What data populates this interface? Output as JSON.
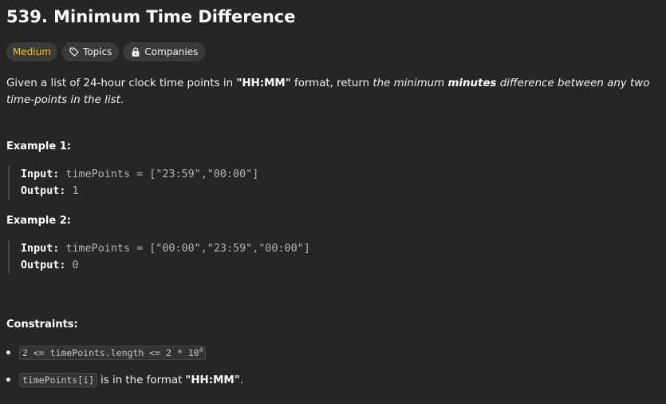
{
  "problem": {
    "title": "539. Minimum Time Difference",
    "difficulty": "Medium",
    "difficulty_color": "#ffc01e",
    "tags": [
      {
        "label": "Topics",
        "icon": "tag-icon"
      },
      {
        "label": "Companies",
        "icon": "lock-icon"
      }
    ]
  },
  "description": {
    "part1": "Given a list of 24-hour clock time points in ",
    "format": "\"HH:MM\"",
    "part2": " format, return ",
    "ital1": "the minimum ",
    "ital_bold": "minutes",
    "ital2": " difference between any two time-points in the list",
    "end": "."
  },
  "examples": [
    {
      "heading": "Example 1:",
      "input_label": "Input:",
      "input_value": " timePoints = [\"23:59\",\"00:00\"]",
      "output_label": "Output:",
      "output_value": " 1"
    },
    {
      "heading": "Example 2:",
      "input_label": "Input:",
      "input_value": " timePoints = [\"00:00\",\"23:59\",\"00:00\"]",
      "output_label": "Output:",
      "output_value": " 0"
    }
  ],
  "constraints": {
    "heading": "Constraints:",
    "c1_code": "2 <= timePoints.length <= 2 * 10",
    "c1_sup": "4",
    "c2_code": "timePoints[i]",
    "c2_text": "is in the format",
    "c2_bold": "\"HH:MM\"",
    "c2_end": "."
  }
}
